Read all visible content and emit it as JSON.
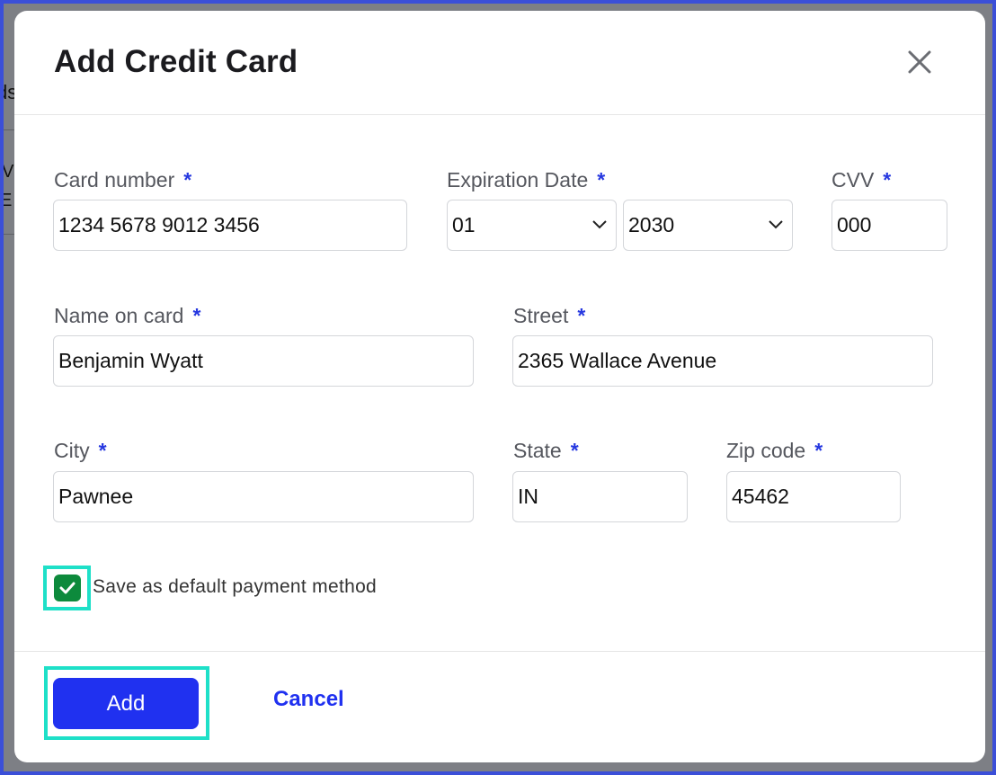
{
  "background": {
    "fragments": [
      "ds",
      "V",
      "E"
    ]
  },
  "modal": {
    "title": "Add Credit Card",
    "close_icon": "close-icon"
  },
  "fields": {
    "card_number": {
      "label": "Card number",
      "required_mark": "*",
      "value": "1234 5678 9012 3456"
    },
    "expiration": {
      "label": "Expiration Date",
      "required_mark": "*",
      "month": "01",
      "year": "2030"
    },
    "cvv": {
      "label": "CVV",
      "required_mark": "*",
      "value": "000"
    },
    "name_on_card": {
      "label": "Name on card",
      "required_mark": "*",
      "value": "Benjamin Wyatt"
    },
    "street": {
      "label": "Street",
      "required_mark": "*",
      "value": "2365 Wallace Avenue"
    },
    "city": {
      "label": "City",
      "required_mark": "*",
      "value": "Pawnee"
    },
    "state": {
      "label": "State",
      "required_mark": "*",
      "value": "IN"
    },
    "zip": {
      "label": "Zip code",
      "required_mark": "*",
      "value": "45462"
    }
  },
  "default_payment": {
    "label": "Save as default payment method",
    "checked": true
  },
  "footer": {
    "add_label": "Add",
    "cancel_label": "Cancel"
  },
  "colors": {
    "accent": "#2031f0",
    "required": "#2638e0",
    "checkbox": "#0d8a3c",
    "highlight": "#1ee0c8",
    "frame": "#3b4fd8"
  }
}
